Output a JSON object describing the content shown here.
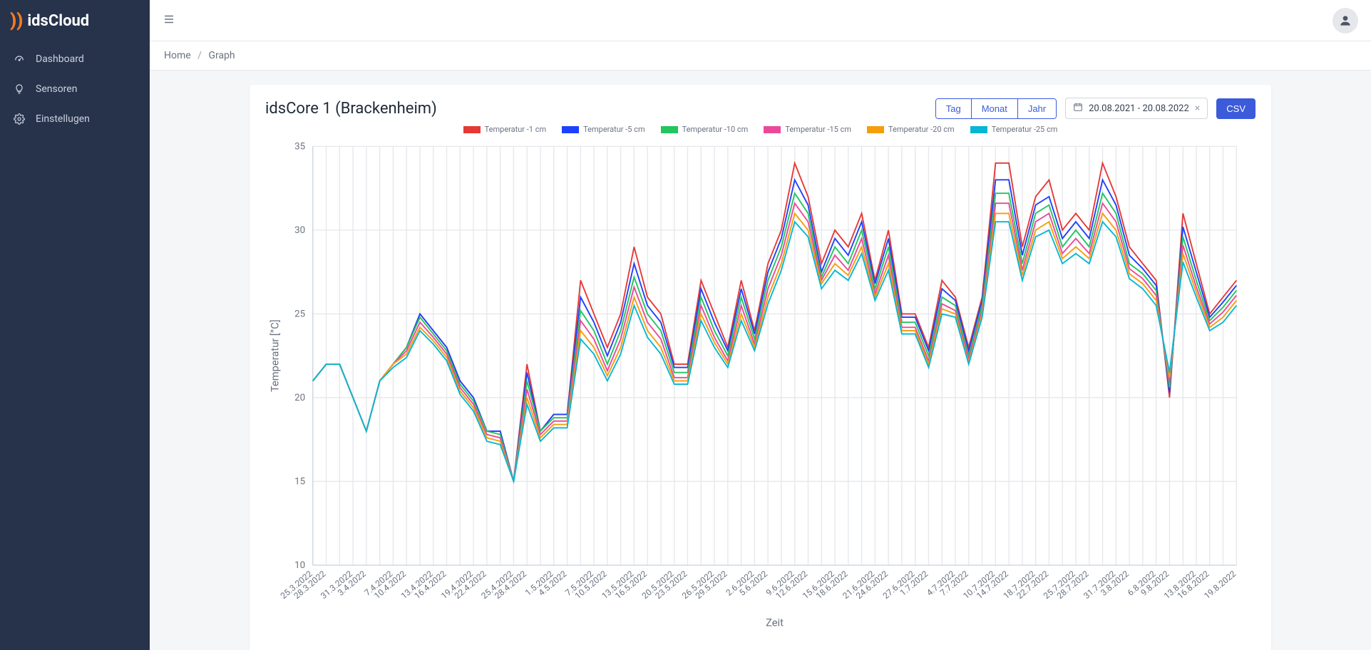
{
  "brand": {
    "name": "idsCloud"
  },
  "sidebar": {
    "items": [
      {
        "label": "Dashboard"
      },
      {
        "label": "Sensoren"
      },
      {
        "label": "Einstellugen"
      }
    ]
  },
  "breadcrumb": {
    "home": "Home",
    "current": "Graph"
  },
  "card": {
    "title": "idsCore 1 (Brackenheim)",
    "range_buttons": {
      "day": "Tag",
      "month": "Monat",
      "year": "Jahr"
    },
    "date_range": "20.08.2021 - 20.08.2022",
    "csv_label": "CSV"
  },
  "chart_data": {
    "type": "line",
    "title": "",
    "xlabel": "Zeit",
    "ylabel": "Temperatur [°C]",
    "ylim": [
      10,
      35
    ],
    "yticks": [
      10,
      15,
      20,
      25,
      30,
      35
    ],
    "categories": [
      "25.3.2022",
      "28.3.2022",
      "31.3.2022",
      "3.4.2022",
      "7.4.2022",
      "10.4.2022",
      "13.4.2022",
      "16.4.2022",
      "19.4.2022",
      "22.4.2022",
      "25.4.2022",
      "28.4.2022",
      "1.5.2022",
      "4.5.2022",
      "7.5.2022",
      "10.5.2022",
      "13.5.2022",
      "16.5.2022",
      "20.5.2022",
      "23.5.2022",
      "26.5.2022",
      "29.5.2022",
      "2.6.2022",
      "5.6.2022",
      "9.6.2022",
      "12.6.2022",
      "15.6.2022",
      "18.6.2022",
      "21.6.2022",
      "24.6.2022",
      "27.6.2022",
      "1.7.2022",
      "4.7.2022",
      "7.7.2022",
      "10.7.2022",
      "14.7.2022",
      "18.7.2022",
      "22.7.2022",
      "25.7.2022",
      "28.7.2022",
      "31.7.2022",
      "3.8.2022",
      "6.8.2022",
      "9.8.2022",
      "13.8.2022",
      "16.8.2022",
      "19.8.2022"
    ],
    "series": [
      {
        "name": "Temperatur -1 cm",
        "color": "#e53935",
        "values": [
          21,
          22,
          22,
          20,
          18,
          21,
          22,
          23,
          25,
          24,
          23,
          21,
          20,
          18,
          18,
          15,
          22,
          18,
          19,
          19,
          27,
          25,
          23,
          25,
          29,
          26,
          25,
          22,
          22,
          27,
          25,
          23,
          27,
          24,
          28,
          30,
          34,
          32,
          28,
          30,
          29,
          31,
          27,
          30,
          25,
          25,
          23,
          27,
          26,
          23,
          26,
          34,
          34,
          29,
          32,
          33,
          30,
          31,
          30,
          34,
          32,
          29,
          28,
          27,
          20,
          31,
          28,
          25,
          26,
          27
        ]
      },
      {
        "name": "Temperatur -5 cm",
        "color": "#1e40ff",
        "values": [
          21,
          22,
          22,
          20,
          18,
          21,
          22,
          23,
          25,
          24,
          23,
          21,
          20,
          18,
          18,
          15,
          21.5,
          18,
          19,
          19,
          26,
          24.5,
          22.5,
          24.5,
          28,
          25.5,
          24.5,
          21.8,
          21.8,
          26.5,
          24.5,
          22.8,
          26.5,
          23.8,
          27.5,
          29.5,
          33,
          31.5,
          27.5,
          29.5,
          28.5,
          30.5,
          26.8,
          29.5,
          24.8,
          24.8,
          22.8,
          26.5,
          25.8,
          22.8,
          25.8,
          33,
          33,
          28.5,
          31.5,
          32,
          29.5,
          30.5,
          29.5,
          33,
          31.5,
          28.5,
          27.7,
          26.7,
          20.3,
          30.2,
          27.5,
          24.8,
          25.7,
          26.7
        ]
      },
      {
        "name": "Temperatur -10 cm",
        "color": "#22c55e",
        "values": [
          21,
          22,
          22,
          20,
          18,
          21,
          22,
          23,
          24.8,
          23.8,
          22.8,
          20.8,
          19.8,
          18,
          17.8,
          15,
          21,
          18,
          18.8,
          18.8,
          25.2,
          24,
          22,
          24,
          27.2,
          25,
          24,
          21.5,
          21.5,
          26,
          24,
          22.5,
          26,
          23.5,
          27,
          29,
          32.2,
          31,
          27.2,
          29,
          28,
          30,
          26.5,
          29,
          24.5,
          24.5,
          22.5,
          26,
          25.5,
          22.5,
          25.5,
          32.2,
          32.2,
          28,
          31,
          31.5,
          29,
          30,
          29,
          32.2,
          31,
          28,
          27.4,
          26.4,
          20.6,
          29.6,
          27,
          24.6,
          25.4,
          26.4
        ]
      },
      {
        "name": "Temperatur -15 cm",
        "color": "#ec4899",
        "values": [
          21,
          22,
          22,
          20,
          18,
          21,
          22,
          22.8,
          24.5,
          23.6,
          22.6,
          20.6,
          19.6,
          17.8,
          17.6,
          15,
          20.5,
          17.8,
          18.6,
          18.6,
          24.6,
          23.5,
          21.6,
          23.5,
          26.6,
          24.5,
          23.5,
          21.2,
          21.2,
          25.5,
          23.6,
          22.2,
          25.5,
          23.2,
          26.5,
          28.5,
          31.6,
          30.5,
          27,
          28.5,
          27.6,
          29.5,
          26.2,
          28.5,
          24.2,
          24.2,
          22.2,
          25.6,
          25.2,
          22.3,
          25.2,
          31.6,
          31.6,
          27.6,
          30.5,
          31,
          28.6,
          29.5,
          28.6,
          31.6,
          30.5,
          27.7,
          27.1,
          26.1,
          20.9,
          29.1,
          26.6,
          24.4,
          25.1,
          26.1
        ]
      },
      {
        "name": "Temperatur -20 cm",
        "color": "#f59e0b",
        "values": [
          21,
          22,
          22,
          20,
          18,
          21,
          22,
          22.6,
          24.2,
          23.4,
          22.4,
          20.4,
          19.4,
          17.6,
          17.4,
          15,
          20,
          17.6,
          18.4,
          18.4,
          24,
          23,
          21.3,
          23,
          26,
          24,
          23,
          21,
          21,
          25,
          23.3,
          22,
          25,
          23,
          26,
          28,
          31,
          30,
          26.8,
          28,
          27.3,
          29,
          26,
          28,
          24,
          24,
          22,
          25.3,
          25,
          22.1,
          25,
          31,
          31,
          27.3,
          30,
          30.5,
          28.3,
          29,
          28.3,
          31,
          30,
          27.4,
          26.8,
          25.8,
          21.2,
          28.6,
          26.3,
          24.2,
          24.8,
          25.8
        ]
      },
      {
        "name": "Temperatur -25 cm",
        "color": "#06b6d4",
        "values": [
          21,
          22,
          22,
          20,
          18,
          21,
          21.8,
          22.4,
          24,
          23.2,
          22.2,
          20.2,
          19.2,
          17.4,
          17.2,
          15,
          19.6,
          17.4,
          18.2,
          18.2,
          23.5,
          22.6,
          21,
          22.6,
          25.5,
          23.6,
          22.6,
          20.8,
          20.8,
          24.6,
          23,
          21.8,
          24.6,
          22.8,
          25.6,
          27.6,
          30.5,
          29.6,
          26.5,
          27.6,
          27,
          28.6,
          25.8,
          27.6,
          23.8,
          23.8,
          21.8,
          25,
          24.8,
          22,
          24.8,
          30.5,
          30.5,
          27,
          29.6,
          30,
          28,
          28.6,
          28,
          30.5,
          29.6,
          27.1,
          26.5,
          25.5,
          21.5,
          28.1,
          26,
          24,
          24.5,
          25.5
        ]
      }
    ]
  }
}
